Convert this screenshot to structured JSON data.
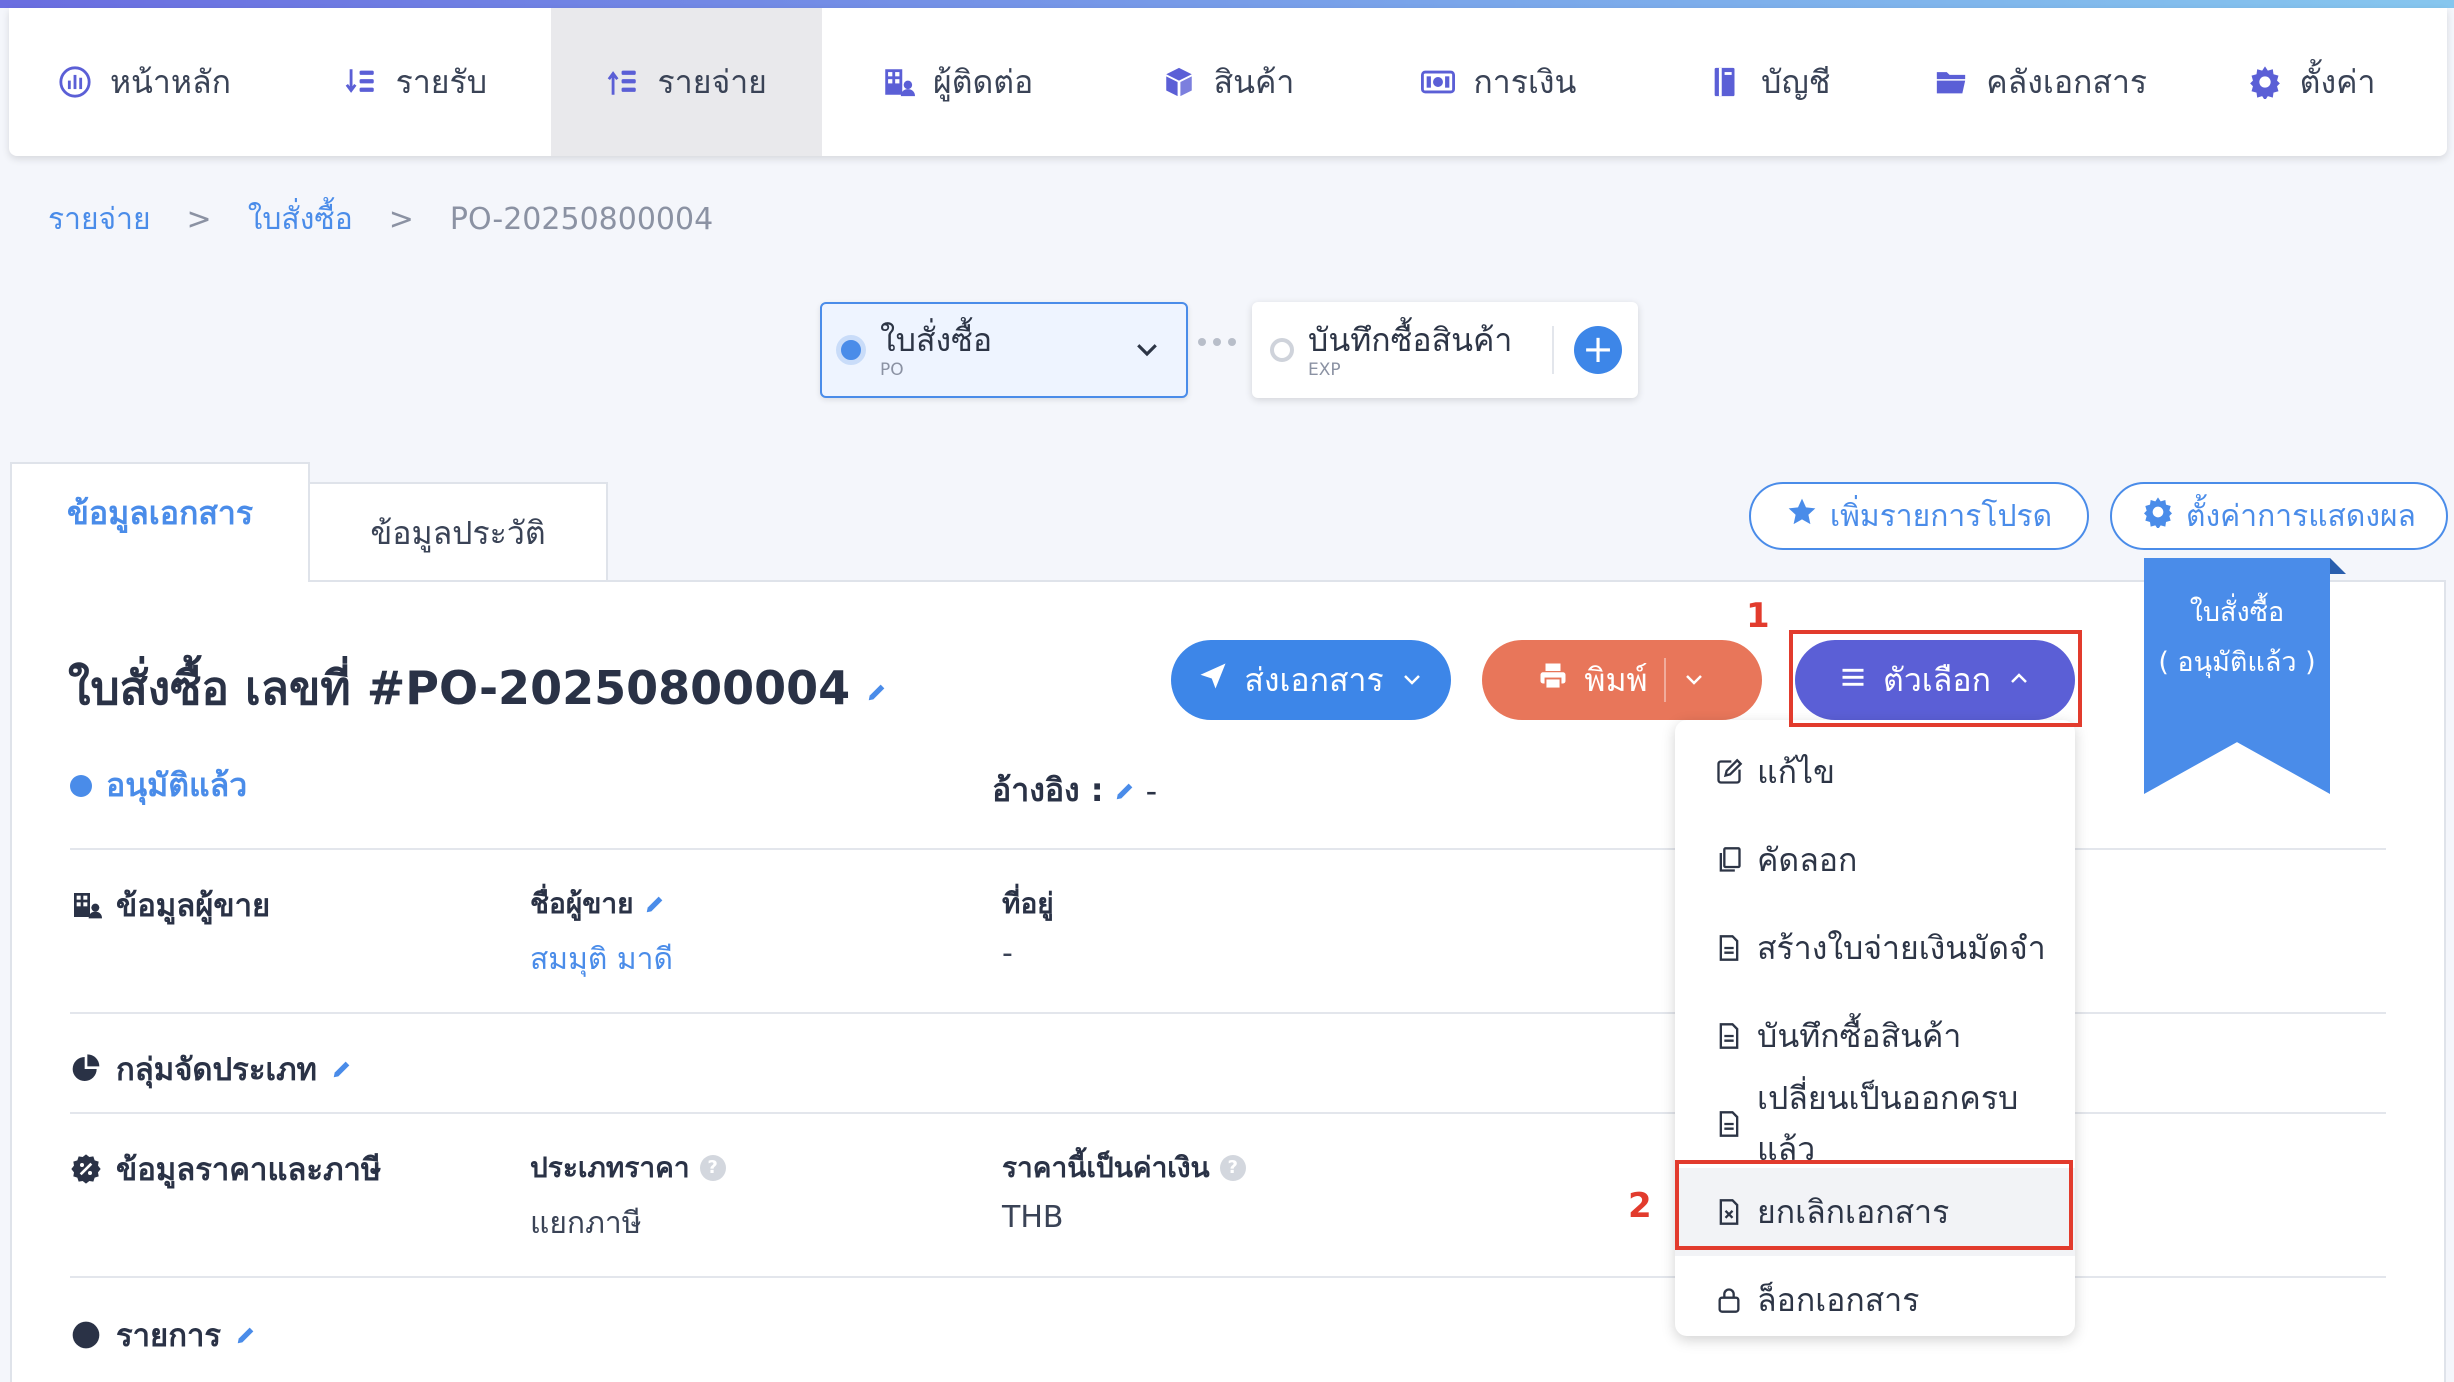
{
  "nav": {
    "items": [
      {
        "label": "หน้าหลัก",
        "icon": "dashboard-icon"
      },
      {
        "label": "รายรับ",
        "icon": "income-icon"
      },
      {
        "label": "รายจ่าย",
        "icon": "expense-icon",
        "active": true
      },
      {
        "label": "ผู้ติดต่อ",
        "icon": "contacts-icon"
      },
      {
        "label": "สินค้า",
        "icon": "box-icon"
      },
      {
        "label": "การเงิน",
        "icon": "money-icon"
      },
      {
        "label": "บัญชี",
        "icon": "book-icon"
      },
      {
        "label": "คลังเอกสาร",
        "icon": "folder-icon"
      },
      {
        "label": "ตั้งค่า",
        "icon": "gear-icon"
      }
    ]
  },
  "breadcrumb": {
    "items": [
      "รายจ่าย",
      "ใบสั่งซื้อ",
      "PO-20250800004"
    ],
    "separator": ">"
  },
  "flow": {
    "current": {
      "title": "ใบสั่งซื้อ",
      "code": "PO"
    },
    "next": {
      "title": "บันทึกซื้อสินค้า",
      "code": "EXP"
    }
  },
  "tabs": [
    "ข้อมูลเอกสาร",
    "ข้อมูลประวัติ"
  ],
  "toolbar": {
    "favorite_label": "เพิ่มรายการโปรด",
    "display_settings_label": "ตั้งค่าการแสดงผล"
  },
  "document": {
    "title": "ใบสั่งซื้อ เลขที่ #PO-20250800004",
    "status": "อนุมัติแล้ว",
    "reference_label": "อ้างอิง :",
    "reference_value": "-",
    "ribbon_line1": "ใบสั่งซื้อ",
    "ribbon_line2": "( อนุมัติแล้ว )"
  },
  "actions": {
    "send_label": "ส่งเอกสาร",
    "print_label": "พิมพ์",
    "options_label": "ตัวเลือก"
  },
  "annotations": {
    "step1": "1",
    "step2": "2"
  },
  "sections": {
    "vendor": {
      "title": "ข้อมูลผู้ขาย",
      "name_label": "ชื่อผู้ขาย",
      "name_value": "สมมุติ มาดี",
      "address_label": "ที่อยู่",
      "address_value": "-"
    },
    "category": {
      "title": "กลุ่มจัดประเภท"
    },
    "pricing": {
      "title": "ข้อมูลราคาและภาษี",
      "price_type_label": "ประเภทราคา",
      "price_type_value": "แยกภาษี",
      "currency_label": "ราคานี้เป็นค่าเงิน",
      "currency_value": "THB"
    },
    "items": {
      "title": "รายการ"
    }
  },
  "options_menu": [
    {
      "label": "แก้ไข",
      "icon": "edit-icon"
    },
    {
      "label": "คัดลอก",
      "icon": "copy-icon"
    },
    {
      "label": "สร้างใบจ่ายเงินมัดจำ",
      "icon": "document-icon"
    },
    {
      "label": "บันทึกซื้อสินค้า",
      "icon": "document-icon"
    },
    {
      "label": "เปลี่ยนเป็นออกครบแล้ว",
      "icon": "document-icon"
    },
    {
      "label": "ยกเลิกเอกสาร",
      "icon": "cancel-document-icon",
      "highlighted": true
    },
    {
      "label": "ล็อกเอกสาร",
      "icon": "lock-icon"
    }
  ],
  "colors": {
    "primary": "#4a8ce9",
    "purple": "#5b5fd6",
    "print": "#e8765a",
    "highlight_red": "#e23b2d"
  }
}
